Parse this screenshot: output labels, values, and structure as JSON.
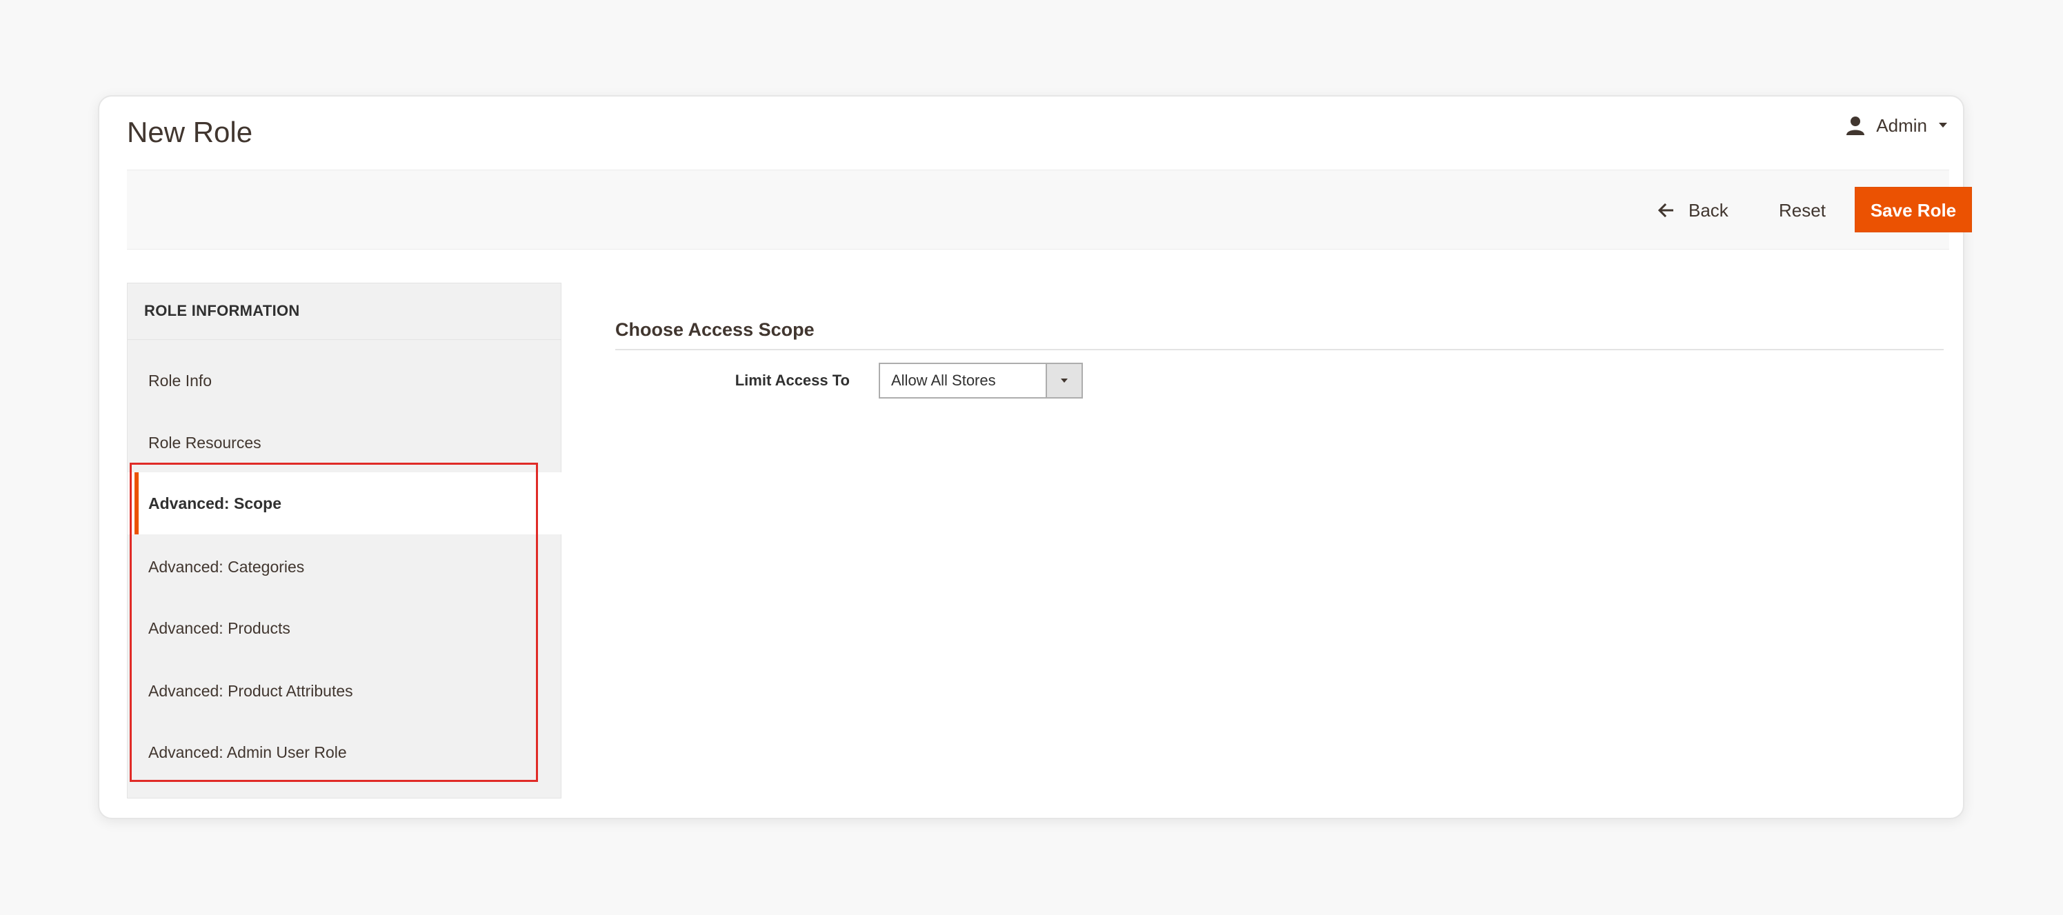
{
  "header": {
    "page_title": "New Role",
    "user_name": "Admin",
    "user_icon": "user-icon",
    "user_caret_icon": "caret-down-icon"
  },
  "actions": {
    "back_label": "Back",
    "back_icon": "arrow-left-icon",
    "reset_label": "Reset",
    "save_label": "Save Role",
    "save_color": "#eb5202"
  },
  "tabs": {
    "title": "ROLE INFORMATION",
    "items": [
      {
        "label": "Role Info",
        "active": false
      },
      {
        "label": "Role Resources",
        "active": false
      },
      {
        "label": "Advanced: Scope",
        "active": true
      },
      {
        "label": "Advanced: Categories",
        "active": false
      },
      {
        "label": "Advanced: Products",
        "active": false
      },
      {
        "label": "Advanced: Product Attributes",
        "active": false
      },
      {
        "label": "Advanced: Admin User Role",
        "active": false
      }
    ],
    "active_accent_color": "#eb5202",
    "highlight_color": "#e02b27"
  },
  "main": {
    "section_title": "Choose Access Scope",
    "limit_access_label": "Limit Access To",
    "limit_access_value": "Allow All Stores",
    "select_arrow_icon": "caret-down-icon"
  }
}
